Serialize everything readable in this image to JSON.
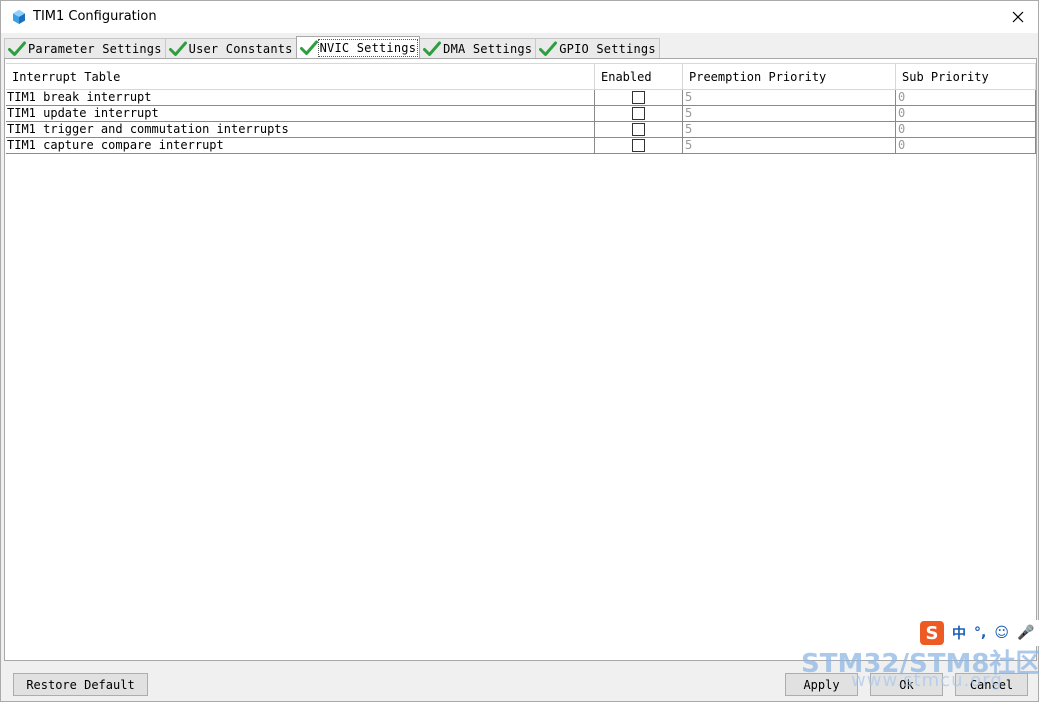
{
  "window": {
    "title": "TIM1 Configuration"
  },
  "tabs": [
    {
      "label": "Parameter Settings",
      "active": false
    },
    {
      "label": "User Constants",
      "active": false
    },
    {
      "label": "NVIC Settings",
      "active": true
    },
    {
      "label": "DMA Settings",
      "active": false
    },
    {
      "label": "GPIO Settings",
      "active": false
    }
  ],
  "table": {
    "columns": {
      "interrupt": "Interrupt Table",
      "enabled": "Enabled",
      "preemption": "Preemption Priority",
      "sub": "Sub Priority"
    },
    "rows": [
      {
        "name": "TIM1 break interrupt",
        "enabled": false,
        "preemption": "5",
        "sub": "0"
      },
      {
        "name": "TIM1 update interrupt",
        "enabled": false,
        "preemption": "5",
        "sub": "0"
      },
      {
        "name": "TIM1 trigger and commutation interrupts",
        "enabled": false,
        "preemption": "5",
        "sub": "0"
      },
      {
        "name": "TIM1 capture compare interrupt",
        "enabled": false,
        "preemption": "5",
        "sub": "0"
      }
    ]
  },
  "buttons": {
    "restore": "Restore Default",
    "apply": "Apply",
    "ok": "Ok",
    "cancel": "Cancel"
  },
  "ime": {
    "logo": "S",
    "items": [
      "中",
      "°,",
      "☺",
      "🎤"
    ]
  },
  "watermark": {
    "brand": "STM32/STM8社区",
    "url": "www.stmcu.org"
  },
  "colors": {
    "check_green": "#2e9e3e",
    "ime_orange": "#ee5a24",
    "watermark_blue": "#8fb7e3"
  }
}
